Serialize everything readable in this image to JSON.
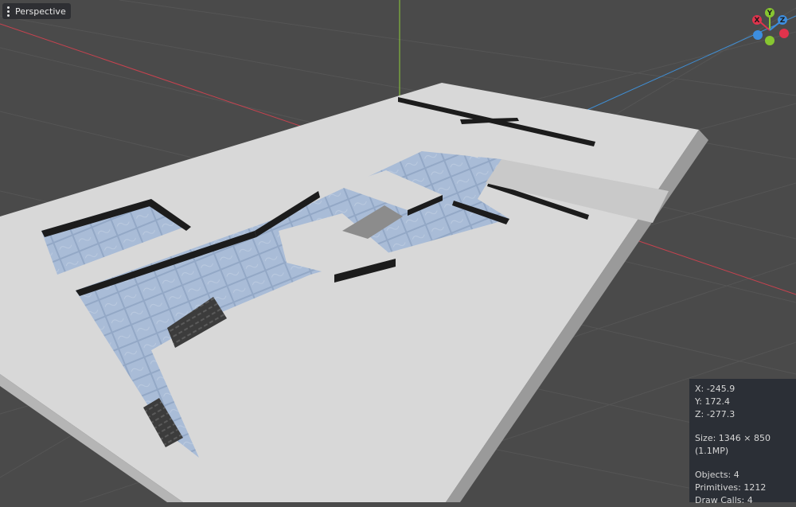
{
  "viewport": {
    "view_label": "Perspective",
    "menu_icon": "kebab-icon"
  },
  "gizmo": {
    "labels": {
      "x": "X",
      "y": "Y",
      "z": "Z"
    },
    "colors": {
      "x": "#e0334c",
      "y": "#87c631",
      "z": "#3d8ee0"
    }
  },
  "colors": {
    "background": "#4a4a4a",
    "grid": "#555555",
    "floor": "#d8d8d8",
    "water": "#a9bcd7",
    "wall": "#1c1c1c",
    "axis_x": "#c8424f",
    "axis_y": "#8fcf3a",
    "axis_z": "#3f8fd6"
  },
  "stats": {
    "x": "X: -245.9",
    "y": "Y: 172.4",
    "z": "Z: -277.3",
    "size": "Size: 1346 × 850 (1.1MP)",
    "objects": "Objects: 4",
    "primitives": "Primitives: 1212",
    "draw_calls": "Draw Calls: 4"
  }
}
